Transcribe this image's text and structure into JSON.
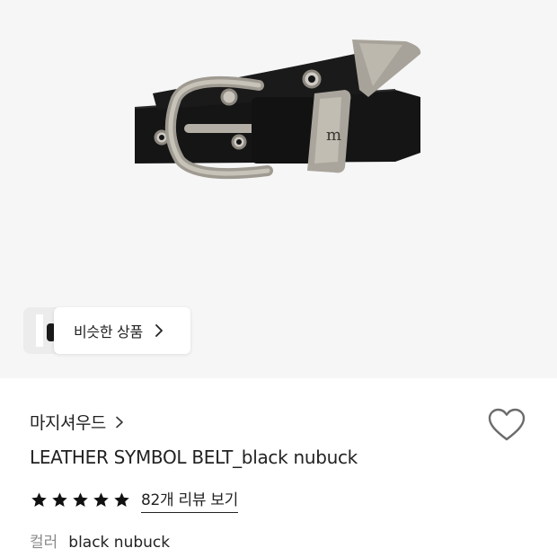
{
  "product_image": {
    "icon": "belt-product-photo"
  },
  "similar_products": {
    "label": "비슷한 상품",
    "icon": "chevron-right-icon"
  },
  "brand": {
    "name": "마지셔우드",
    "icon": "chevron-right-icon"
  },
  "like": {
    "icon": "heart-outline-icon"
  },
  "product": {
    "title": "LEATHER SYMBOL BELT_black nubuck"
  },
  "rating": {
    "stars": 5,
    "max_stars": 5,
    "review_link": "82개 리뷰 보기"
  },
  "option": {
    "label": "컬러",
    "value": "black nubuck"
  },
  "colors": {
    "hero_bg": "#f6f6f6",
    "text": "#222222",
    "muted": "#8a8a8a"
  }
}
